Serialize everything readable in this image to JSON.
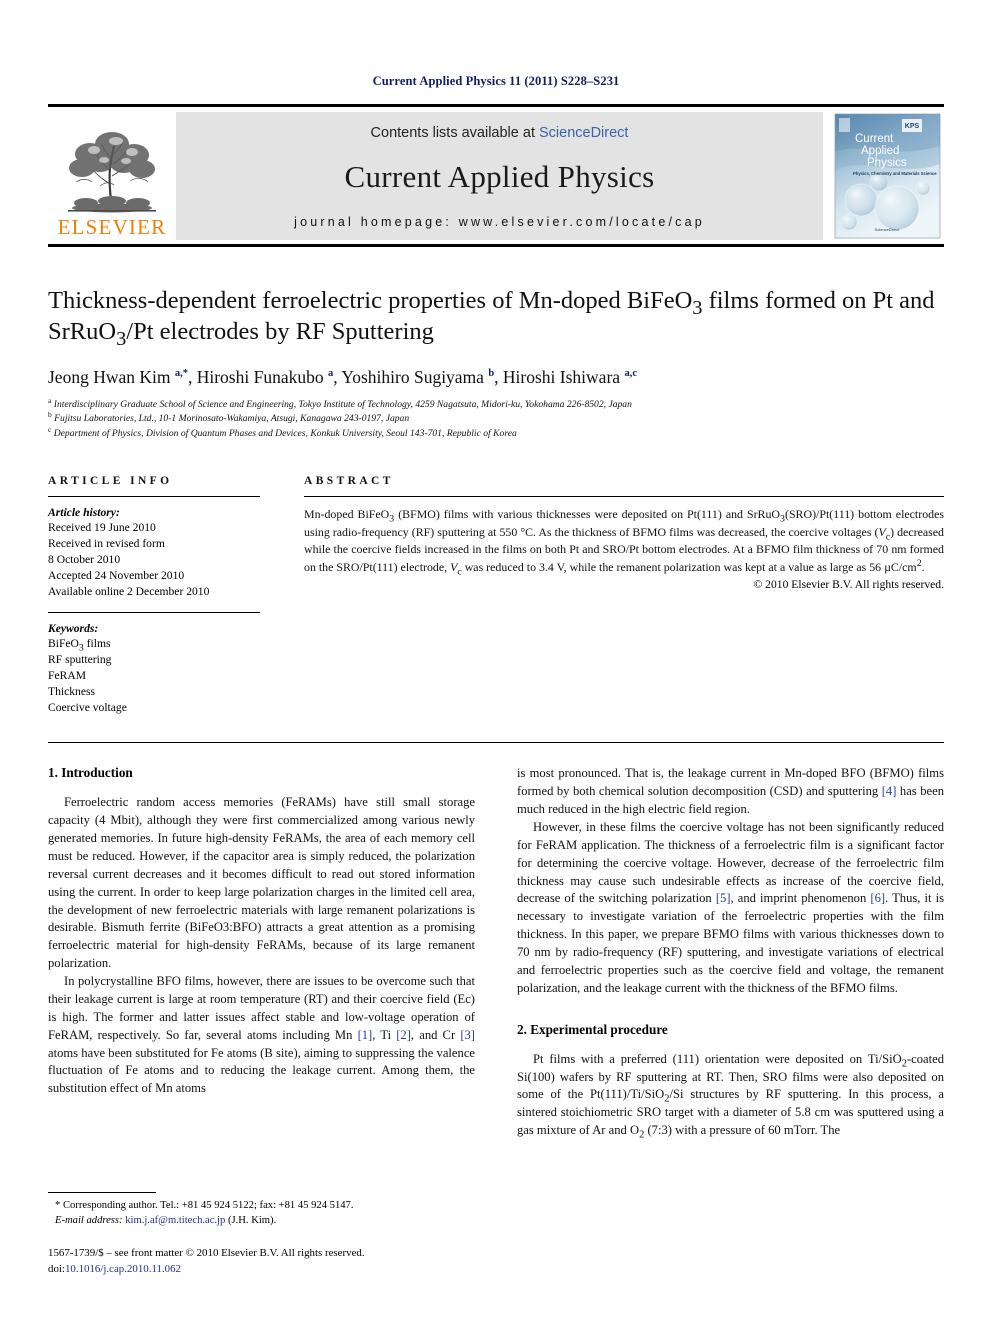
{
  "running_head": "Current Applied Physics 11 (2011) S228–S231",
  "masthead": {
    "publisher_name": "ELSEVIER",
    "contents_prefix": "Contents lists available at ",
    "contents_link": "ScienceDirect",
    "journal_name": "Current Applied Physics",
    "homepage_line": "journal homepage: www.elsevier.com/locate/cap",
    "cover": {
      "line1": "Current",
      "line2": "Applied",
      "line3": "Physics",
      "subtitle": "Physics, Chemistry and Materials Science",
      "badge": "KPS",
      "footer": "ScienceDirect"
    }
  },
  "article": {
    "title": "Thickness-dependent ferroelectric properties of Mn-doped BiFeO3 films formed on Pt and SrRuO3/Pt electrodes by RF Sputtering",
    "authors_plain": "Jeong Hwan Kim a,*, Hiroshi Funakubo a, Yoshihiro Sugiyama b, Hiroshi Ishiwara a,c",
    "affiliations": [
      {
        "marker": "a",
        "text": "Interdisciplinary Graduate School of Science and Engineering, Tokyo Institute of Technology, 4259 Nagatsuta, Midori-ku, Yokohama 226-8502, Japan"
      },
      {
        "marker": "b",
        "text": "Fujitsu Laboratories, Ltd., 10-1 Morinosato-Wakamiya, Atsugi, Kanagawa 243-0197, Japan"
      },
      {
        "marker": "c",
        "text": "Department of Physics, Division of Quantum Phases and Devices, Konkuk University, Seoul 143-701, Republic of Korea"
      }
    ]
  },
  "article_info": {
    "label": "ARTICLE INFO",
    "history_head": "Article history:",
    "history": [
      "Received 19 June 2010",
      "Received in revised form",
      "8 October 2010",
      "Accepted 24 November 2010",
      "Available online 2 December 2010"
    ],
    "keywords_head": "Keywords:",
    "keywords": [
      "BiFeO3 films",
      "RF sputtering",
      "FeRAM",
      "Thickness",
      "Coercive voltage"
    ]
  },
  "abstract": {
    "label": "ABSTRACT",
    "text": "Mn-doped BiFeO3 (BFMO) films with various thicknesses were deposited on Pt(111) and SrRuO3(SRO)/Pt(111) bottom electrodes using radio-frequency (RF) sputtering at 550 °C. As the thickness of BFMO films was decreased, the coercive voltages (Vc) decreased while the coercive fields increased in the films on both Pt and SRO/Pt bottom electrodes. At a BFMO film thickness of 70 nm formed on the SRO/Pt(111) electrode, Vc was reduced to 3.4 V, while the remanent polarization was kept at a value as large as 56 μC/cm2.",
    "copyright": "© 2010 Elsevier B.V. All rights reserved."
  },
  "sections": {
    "intro_title": "1.  Introduction",
    "intro_p1": "Ferroelectric random access memories (FeRAMs) have still small storage capacity (4 Mbit), although they were first commercialized among various newly generated memories. In future high-density FeRAMs, the area of each memory cell must be reduced. However, if the capacitor area is simply reduced, the polarization reversal current decreases and it becomes difficult to read out stored information using the current. In order to keep large polarization charges in the limited cell area, the development of new ferroelectric materials with large remanent polarizations is desirable. Bismuth ferrite (BiFeO3:BFO) attracts a great attention as a promising ferroelectric material for high-density FeRAMs, because of its large remanent polarization.",
    "intro_p2_a": "In polycrystalline BFO films, however, there are issues to be overcome such that their leakage current is large at room temperature (RT) and their coercive field (Ec) is high. The former and latter issues affect stable and low-voltage operation of FeRAM, respectively. So far, several atoms including Mn ",
    "intro_p2_c1": "[1]",
    "intro_p2_b": ", Ti ",
    "intro_p2_c2": "[2]",
    "intro_p2_c": ", and Cr ",
    "intro_p2_c3": "[3]",
    "intro_p2_d": " atoms have been substituted for Fe atoms (B site), aiming to suppressing the valence fluctuation of Fe atoms and to reducing the leakage current. Among them, the substitution effect of Mn atoms",
    "right_p1_a": "is most pronounced. That is, the leakage current in Mn-doped BFO (BFMO) films formed by both chemical solution decomposition (CSD) and sputtering ",
    "right_p1_c": "[4]",
    "right_p1_b": " has been much reduced in the high electric field region.",
    "right_p2_a": "However, in these films the coercive voltage has not been significantly reduced for FeRAM application. The thickness of a ferroelectric film is a significant factor for determining the coercive voltage. However, decrease of the ferroelectric film thickness may cause such undesirable effects as increase of the coercive field, decrease of the switching polarization ",
    "right_p2_c1": "[5]",
    "right_p2_b": ", and imprint phenomenon ",
    "right_p2_c2": "[6]",
    "right_p2_c": ". Thus, it is necessary to investigate variation of the ferroelectric properties with the film thickness. In this paper, we prepare BFMO films with various thicknesses down to 70 nm by radio-frequency (RF) sputtering, and investigate variations of electrical and ferroelectric properties such as the coercive field and voltage, the remanent polarization, and the leakage current with the thickness of the BFMO films.",
    "exp_title": "2.  Experimental procedure",
    "exp_p1": "Pt films with a preferred (111) orientation were deposited on Ti/SiO2-coated Si(100) wafers by RF sputtering at RT. Then, SRO films were also deposited on some of the Pt(111)/Ti/SiO2/Si structures by RF sputtering. In this process, a sintered stoichiometric SRO target with a diameter of 5.8 cm was sputtered using a gas mixture of Ar and O2 (7:3) with a pressure of 60 mTorr. The"
  },
  "footnotes": {
    "corresponding": "* Corresponding author. Tel.: +81 45 924 5122; fax: +81 45 924 5147.",
    "email_label": "E-mail address:",
    "email": "kim.j.af@m.titech.ac.jp",
    "email_suffix": "(J.H. Kim).",
    "issn_line": "1567-1739/$ – see front matter © 2010 Elsevier B.V. All rights reserved.",
    "doi_label": "doi:",
    "doi": "10.1016/j.cap.2010.11.062"
  },
  "colors": {
    "running_head": "#131c63",
    "elsevier_orange": "#f07f09",
    "link_blue": "#3a63ab",
    "citation_blue": "#2a3d9e",
    "band_gray": "#e3e3e3"
  }
}
